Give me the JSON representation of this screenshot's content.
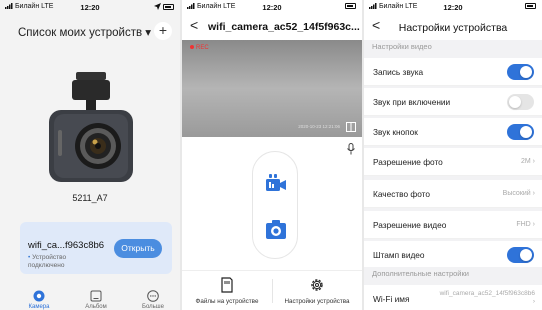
{
  "status_bar": {
    "carrier": "Билайн LTE",
    "time": "12:20"
  },
  "device_list": {
    "title": "Список моих устройств ▾",
    "add_label": "+",
    "camera_name": "5211_A7",
    "card": {
      "device_name": "wifi_ca...f963c8b6",
      "status": "Устройство подключено",
      "open_label": "Открыть"
    },
    "tabs": [
      {
        "label": "Камера",
        "active": true
      },
      {
        "label": "Альбом",
        "active": false
      },
      {
        "label": "Больше",
        "active": false
      }
    ],
    "colors": {
      "accent": "#2f73d9",
      "card_bg": "#dfe9f9"
    }
  },
  "live_view": {
    "back_label": "<",
    "title": "wifi_camera_ac52_14f5f963c...",
    "rec_label": "REC",
    "osd_text": "2020-10-23 12:21:06",
    "controls": [
      "video-record-icon",
      "photo-capture-icon"
    ],
    "bottom": {
      "files_label": "Файлы на устройстве",
      "settings_label": "Настройки устройства"
    }
  },
  "settings": {
    "back_label": "<",
    "title": "Настройки устройства",
    "section_video": "Настройки видео",
    "section_extra": "Дополнительные настройки",
    "rows": [
      {
        "label": "Запись звука",
        "type": "toggle",
        "on": true
      },
      {
        "label": "Звук при включении",
        "type": "toggle",
        "on": false
      },
      {
        "label": "Звук кнопок",
        "type": "toggle",
        "on": true
      },
      {
        "label": "Разрешение фото",
        "type": "value",
        "value": "2M ›"
      },
      {
        "label": "Качество фото",
        "type": "value",
        "value": "Высокий ›"
      },
      {
        "label": "Разрешение видео",
        "type": "value",
        "value": "FHD ›"
      },
      {
        "label": "Штамп видео",
        "type": "toggle",
        "on": true
      }
    ],
    "wifi": {
      "label": "Wi-Fi имя",
      "value": "wifi_camera_ac52_14f5f963c8b6 ›"
    }
  }
}
